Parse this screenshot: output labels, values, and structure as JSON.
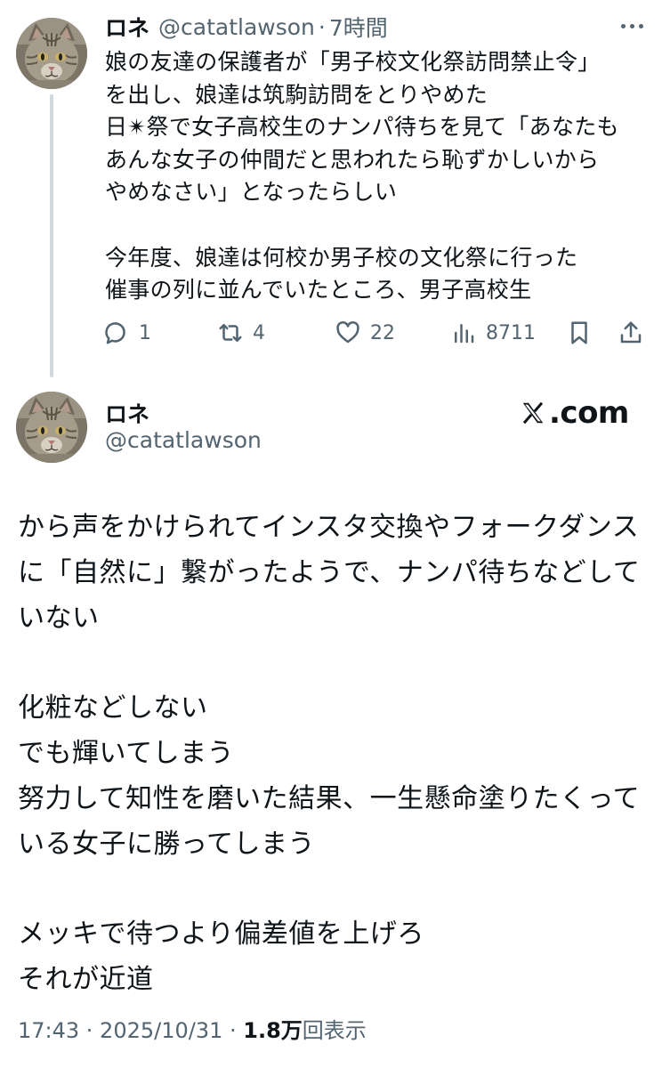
{
  "tweet1": {
    "display_name": "ロネ",
    "handle": "@catatlawson",
    "separator": "·",
    "time": "7時間",
    "text": "娘の友達の保護者が「男子校文化祭訪問禁止令」\nを出し、娘達は筑駒訪問をとりやめた\n日✴祭で女子高校生のナンパ待ちを見て「あなたも\nあんな女子の仲間だと思われたら恥ずかしいから\nやめなさい」となったらしい\n\n今年度、娘達は何校か男子校の文化祭に行った\n催事の列に並んでいたところ、男子高校生",
    "reply_count": "1",
    "repost_count": "4",
    "like_count": "22",
    "view_count": "8711",
    "icons": [
      "more-icon",
      "reply-icon",
      "repost-icon",
      "like-icon",
      "views-icon",
      "bookmark-icon",
      "share-icon"
    ]
  },
  "tweet2": {
    "display_name": "ロネ",
    "handle": "@catatlawson",
    "brand": ".com",
    "brand_icon": "x-logo-icon",
    "text": "から声をかけられてインスタ交換やフォークダンス\nに「自然に」繋がったようで、ナンパ待ちなどして\nいない\n\n化粧などしない\nでも輝いてしまう\n努力して知性を磨いた結果、一生懸命塗りたくって\nいる女子に勝ってしまう\n\nメッキで待つより偏差値を上げろ\nそれが近道",
    "footer_time": "17:43 · 2025/10/31 · ",
    "footer_views_number": "1.8万",
    "footer_views_label": "回表示"
  },
  "colors": {
    "text": "#0f1419",
    "secondary": "#536471",
    "thread_line": "#cfd9de",
    "background": "#ffffff"
  }
}
